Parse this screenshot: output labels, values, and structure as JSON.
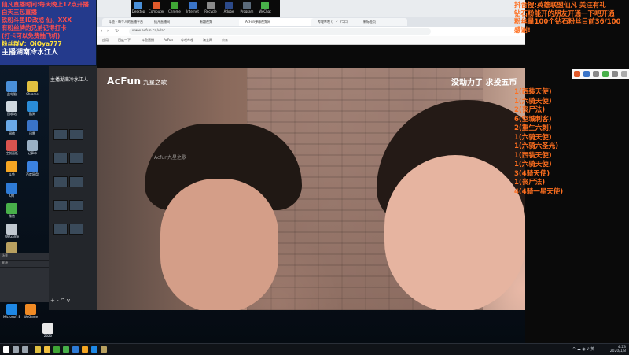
{
  "overlay_left": {
    "lines": [
      "仙凡直播时间:每天晚上12点开播",
      "白天三包直播",
      "铁粉斗鱼ID改成 仙、XXX",
      "有粉丝牌的兄弟记得打卡",
      "(打卡可以免费抽飞机)",
      "粉丝群V：QiQya777"
    ],
    "streamer": "主播湖南冷水江人"
  },
  "browser": {
    "taskbar_top_icons": [
      "Desktop",
      "Computer",
      "Chrome",
      "Internet",
      "Recycle",
      "Adobe",
      "Program",
      "WeChat"
    ],
    "tabs": [
      "斗鱼 - 每个人的直播平台",
      "仙凡直播间",
      "有趣视频",
      "AcFun弹幕视频网",
      "哔哩哔哩 (゜-゜)つロ",
      "新标签页"
    ],
    "address": "www.acfun.cn/v/ac",
    "bookmarks": [
      "应用",
      "百度一下",
      "斗鱼直播",
      "AcFun",
      "哔哩哔哩",
      "淘宝网",
      "京东"
    ]
  },
  "video": {
    "logo": "AcFun",
    "logo_sub": "九星之歌",
    "watermark": "Acfun九星之歌",
    "caption": "没动力了 求投五币"
  },
  "overlay_right": {
    "header": [
      "抖音搜:英雄联盟仙凡  关注有礼",
      "钻石粉能开的朋友开通一下吧开通",
      "粉丝量100个钻石粉丝目前36/100",
      "感谢!"
    ],
    "list": [
      "1(西装天使)",
      "1(六骑天使)",
      "2(丧尸法)",
      "6(空城刺客)",
      "2(重生六刺)",
      "1(六骑天使)",
      "1(六骑六圣光)",
      "1(西装天使)",
      "1(六骑天使)",
      "3(4骑天使)",
      "1(丧尸法)",
      "4(4骑一星天使)"
    ]
  },
  "desktop_icons": [
    "此电脑",
    "回收站",
    "网络",
    "控制面板",
    "斗鱼",
    "QQ",
    "微信",
    "WeGame",
    "英雄联盟",
    "OBS",
    "Chrome",
    "酷狗",
    "迅雷",
    "记事本",
    "百度网盘"
  ],
  "bottom_icons": [
    "Microsoft Edge",
    "WeGame",
    "2020"
  ],
  "obs": {
    "title": "主播湖南冷水江人",
    "scene_label": "场景",
    "source_label": "来源",
    "controls": "+ - ^ v"
  },
  "clock": {
    "time": "4:23",
    "date": "2020/1/8"
  },
  "colors": {
    "overlay_blue": "#243a8c",
    "overlay_orange": "#ff6f1f",
    "overlay_red": "#ff4d4d"
  }
}
